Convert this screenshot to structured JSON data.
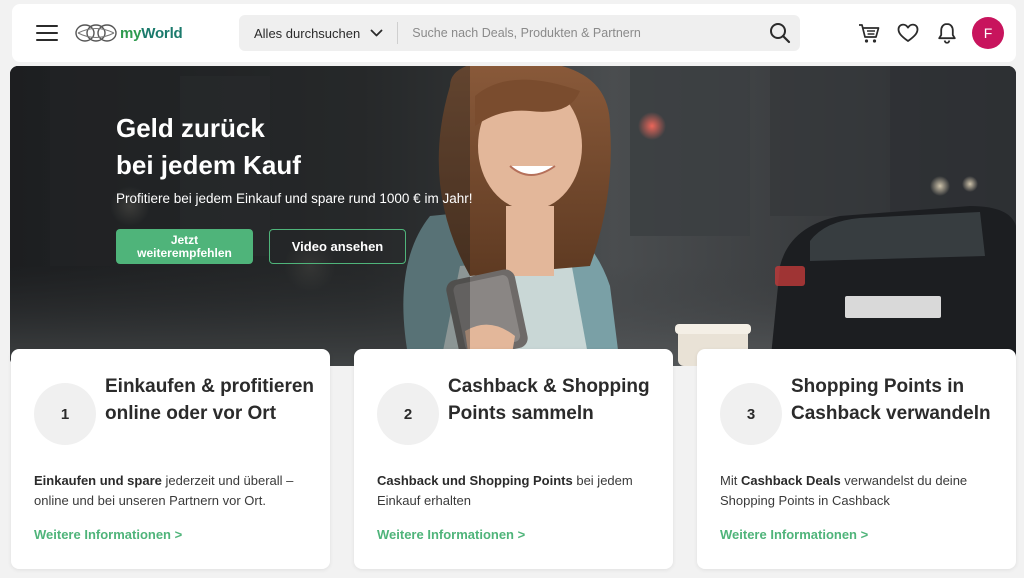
{
  "header": {
    "logo": {
      "my": "my",
      "world": "World"
    },
    "search": {
      "scope_label": "Alles durchsuchen",
      "placeholder": "Suche nach Deals, Produkten & Partnern",
      "value": ""
    },
    "avatar_initial": "F",
    "icons": [
      "menu-icon",
      "search-icon",
      "cart-icon",
      "heart-icon",
      "bell-icon",
      "chevron-down-icon"
    ]
  },
  "hero": {
    "title_line1": "Geld zurück",
    "title_line2": "bei jedem Kauf",
    "subtitle": "Profitiere bei jedem Einkauf und spare rund 1000 € im Jahr!",
    "primary_button": "Jetzt weiterempfehlen",
    "secondary_button": "Video ansehen"
  },
  "cards": [
    {
      "number": "1",
      "title": "Einkaufen & profitieren online oder vor Ort",
      "text_bold": "Einkaufen und spare",
      "text_rest": " jederzeit und überall – online und bei unseren Partnern vor Ort.",
      "link": "Weitere Informationen >"
    },
    {
      "number": "2",
      "title": "Cashback & Shopping Points sammeln",
      "text_bold": "Cashback und Shopping Points",
      "text_rest": " bei jedem Einkauf erhalten",
      "link": "Weitere Informationen >"
    },
    {
      "number": "3",
      "title": "Shopping Points in Cashback verwandeln",
      "text_pre": "Mit ",
      "text_bold": "Cashback Deals",
      "text_rest": " verwandelst du deine Shopping Points in Cashback",
      "link": "Weitere Informationen >"
    }
  ],
  "colors": {
    "accent_green": "#4fb47a",
    "avatar": "#c8145d",
    "logo_green": "#2f9b4f",
    "logo_teal": "#1b7a6c"
  }
}
